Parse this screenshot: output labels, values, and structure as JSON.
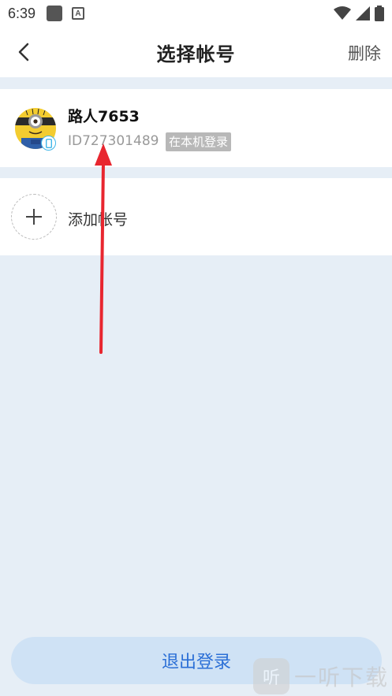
{
  "status_bar": {
    "time": "6:39",
    "notification_badge": "A"
  },
  "header": {
    "title": "选择帐号",
    "delete_label": "删除"
  },
  "account": {
    "name": "路人7653",
    "id_text": "ID727301489",
    "login_tag": "在本机登录"
  },
  "add_account": {
    "label": "添加帐号"
  },
  "logout": {
    "label": "退出登录"
  },
  "watermark": {
    "logo_text": "听",
    "text": "一听下载"
  },
  "colors": {
    "accent": "#2b6fd6",
    "logout_bg": "#cfe2f5",
    "page_bg": "#e6eef6",
    "arrow": "#e8262f",
    "tag_bg": "#b8b8b8"
  },
  "icons": [
    "back-chevron-icon",
    "wifi-icon",
    "signal-icon",
    "battery-icon",
    "plus-icon",
    "phone-device-icon"
  ]
}
